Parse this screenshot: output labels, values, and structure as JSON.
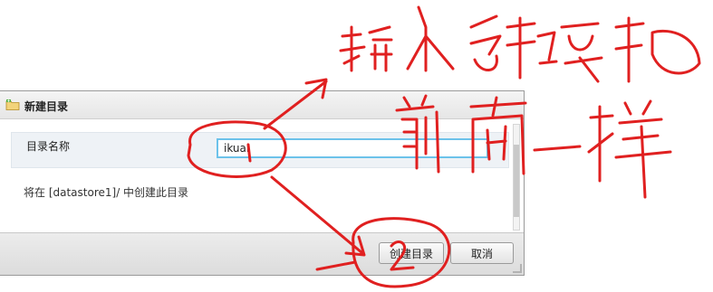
{
  "dialog": {
    "title": "新建目录",
    "icon": "folder-add-icon",
    "field": {
      "label": "目录名称",
      "value": "ikuai"
    },
    "description": "将在 [datastore1]/ 中创建此目录",
    "buttons": {
      "create": "创建目录",
      "cancel": "取消"
    }
  },
  "annotation": {
    "color": "#e02020",
    "note_text": "输入名称要和前面一样",
    "markers": [
      "1",
      "2"
    ]
  }
}
